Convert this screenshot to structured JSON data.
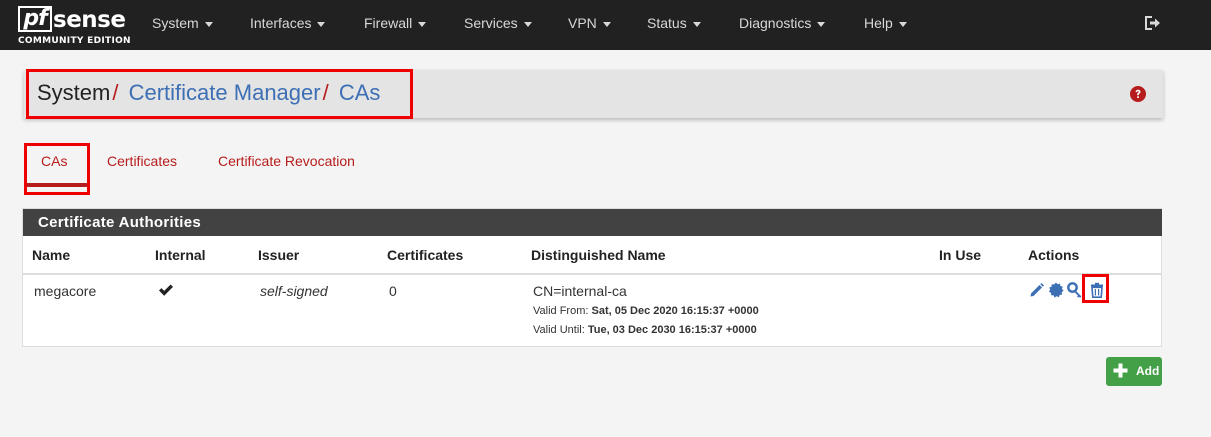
{
  "brand": {
    "logo_pf": "pf",
    "logo_sense": "sense",
    "edition": "COMMUNITY EDITION"
  },
  "nav": {
    "items": [
      {
        "label": "System"
      },
      {
        "label": "Interfaces"
      },
      {
        "label": "Firewall"
      },
      {
        "label": "Services"
      },
      {
        "label": "VPN"
      },
      {
        "label": "Status"
      },
      {
        "label": "Diagnostics"
      },
      {
        "label": "Help"
      }
    ],
    "logout_icon": "logout-icon"
  },
  "breadcrumb": {
    "root": "System",
    "separator": "/",
    "level2": "Certificate Manager",
    "level3": "CAs",
    "help_icon": "question-circle-icon"
  },
  "tabs": [
    {
      "label": "CAs",
      "active": true
    },
    {
      "label": "Certificates",
      "active": false
    },
    {
      "label": "Certificate Revocation",
      "active": false
    }
  ],
  "panel": {
    "title": "Certificate Authorities",
    "columns": [
      "Name",
      "Internal",
      "Issuer",
      "Certificates",
      "Distinguished Name",
      "In Use",
      "Actions"
    ],
    "rows": [
      {
        "name": "megacore",
        "internal": true,
        "issuer": "self-signed",
        "certificates": "0",
        "dn": "CN=internal-ca",
        "valid_from_label": "Valid From:",
        "valid_from": "Sat, 05 Dec 2020 16:15:37 +0000",
        "valid_until_label": "Valid Until:",
        "valid_until": "Tue, 03 Dec 2030 16:15:37 +0000",
        "in_use": "",
        "actions": [
          "pencil-icon",
          "certificate-icon",
          "key-icon",
          "trash-icon"
        ]
      }
    ]
  },
  "add_button": {
    "label": "Add",
    "icon": "plus-icon"
  },
  "colors": {
    "navbar": "#212121",
    "accent_red": "#b71c1c",
    "link_blue": "#3d6fb5",
    "panel_header": "#424242",
    "add_green": "#43a047",
    "highlight_red": "#e00000"
  }
}
